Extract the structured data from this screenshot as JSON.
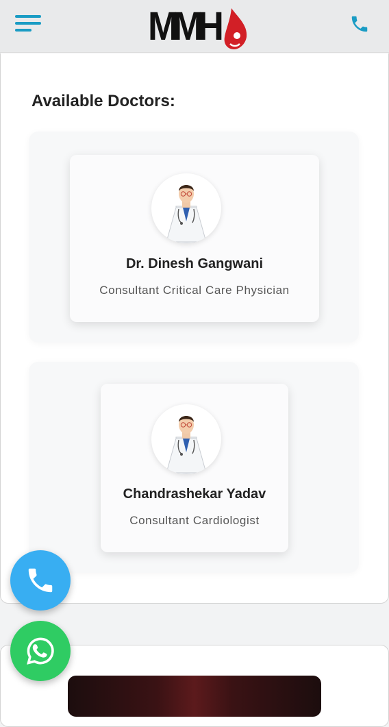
{
  "header": {
    "logo_text": "MMH",
    "menu_icon": "hamburger-menu-icon",
    "phone_icon": "phone-icon",
    "accent_color": "#1a9cc4"
  },
  "main": {
    "section_title": "Available Doctors:",
    "doctors": [
      {
        "name": "Dr. Dinesh Gangwani",
        "role": "Consultant Critical Care Physician",
        "avatar_icon": "doctor-avatar-icon"
      },
      {
        "name": "Chandrashekar Yadav",
        "role": "Consultant Cardiologist",
        "avatar_icon": "doctor-avatar-icon"
      }
    ]
  },
  "floating_buttons": {
    "call_icon": "phone-icon",
    "call_color": "#38aef2",
    "whatsapp_icon": "whatsapp-icon",
    "whatsapp_color": "#2fcc63"
  }
}
